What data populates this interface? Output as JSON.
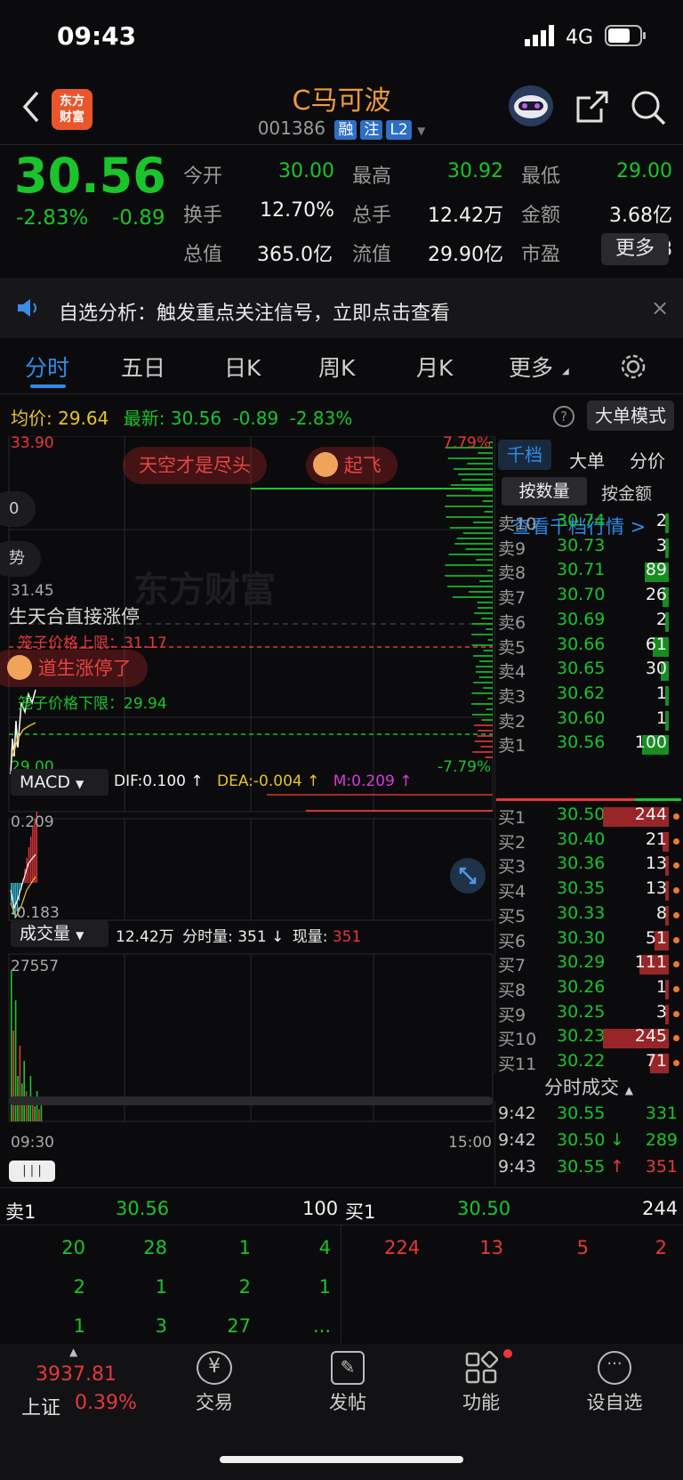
{
  "status": {
    "time": "09:43",
    "network": "4G"
  },
  "header": {
    "title": "C马可波",
    "code": "001386",
    "tags": [
      "融",
      "注",
      "L2"
    ],
    "logo_text": "东方\n财富"
  },
  "quote": {
    "price": "30.56",
    "change_pct": "-2.83%",
    "change": "-0.89",
    "cells": [
      {
        "label": "今开",
        "value": "30.00",
        "color": "green"
      },
      {
        "label": "最高",
        "value": "30.92",
        "color": "green"
      },
      {
        "label": "最低",
        "value": "29.00",
        "color": "green"
      },
      {
        "label": "换手",
        "value": "12.70%",
        "color": "white"
      },
      {
        "label": "总手",
        "value": "12.42万",
        "color": "white"
      },
      {
        "label": "金额",
        "value": "3.68亿",
        "color": "white"
      },
      {
        "label": "总值",
        "value": "365.0亿",
        "color": "white"
      },
      {
        "label": "流值",
        "value": "29.90亿",
        "color": "white"
      },
      {
        "label": "市盈",
        "value": "27.88",
        "color": "white"
      }
    ],
    "more_label": "更多"
  },
  "notice": {
    "text": "自选分析：触发重点关注信号，立即点击查看"
  },
  "tabs": [
    "分时",
    "五日",
    "日K",
    "周K",
    "月K",
    "更多"
  ],
  "avg_row": {
    "avg_label": "均价:",
    "avg_value": "29.64",
    "latest_label": "最新:",
    "latest_value": "30.56",
    "change": "-0.89",
    "change_pct": "-2.83%"
  },
  "big_order_label": "大单模式",
  "intraday": {
    "price_high": "33.90",
    "price_low": "29.00",
    "pct_high": "7.79%",
    "pct_low": "-7.79%",
    "mid_price": "31.45",
    "limit_upper": "笼子价格上限：31.17",
    "limit_lower": "笼子价格下限：29.94",
    "bubbles": [
      "天空才是尽头",
      "起飞",
      "生天合直接涨停",
      "道生涨停了"
    ],
    "side_chips": [
      "0",
      "势"
    ],
    "watermark": "东方财富"
  },
  "macd": {
    "label": "MACD",
    "dif": "DIF:0.100 ↑",
    "dea": "DEA:-0.004 ↑",
    "m": "M:0.209 ↑",
    "top": "0.209",
    "bottom": "-0.183"
  },
  "volume": {
    "label": "成交量",
    "total": "12.42万",
    "tick_label": "分时量: 351 ↓",
    "now_label": "现量:",
    "now_value": "351",
    "max": "27557",
    "time_start": "09:30",
    "time_end": "15:00"
  },
  "right_panel": {
    "tabs": [
      "千档",
      "大单",
      "分价"
    ],
    "sub_tabs": [
      "按数量",
      "按金额"
    ],
    "view_link": "查看千档行情 >",
    "asks": [
      {
        "label": "卖10",
        "price": "30.74",
        "vol": "2",
        "bar": 0.02
      },
      {
        "label": "卖9",
        "price": "30.73",
        "vol": "3",
        "bar": 0.03
      },
      {
        "label": "卖8",
        "price": "30.71",
        "vol": "89",
        "bar": 0.36
      },
      {
        "label": "卖7",
        "price": "30.70",
        "vol": "26",
        "bar": 0.1
      },
      {
        "label": "卖6",
        "price": "30.69",
        "vol": "2",
        "bar": 0.02
      },
      {
        "label": "卖5",
        "price": "30.66",
        "vol": "61",
        "bar": 0.25
      },
      {
        "label": "卖4",
        "price": "30.65",
        "vol": "30",
        "bar": 0.12
      },
      {
        "label": "卖3",
        "price": "30.62",
        "vol": "1",
        "bar": 0.01
      },
      {
        "label": "卖2",
        "price": "30.60",
        "vol": "1",
        "bar": 0.01
      },
      {
        "label": "卖1",
        "price": "30.56",
        "vol": "100",
        "bar": 0.4
      }
    ],
    "bids": [
      {
        "label": "买1",
        "price": "30.50",
        "vol": "244",
        "bar": 1.0,
        "dot": true
      },
      {
        "label": "买2",
        "price": "30.40",
        "vol": "21",
        "bar": 0.09,
        "dot": true
      },
      {
        "label": "买3",
        "price": "30.36",
        "vol": "13",
        "bar": 0.05,
        "dot": true
      },
      {
        "label": "买4",
        "price": "30.35",
        "vol": "13",
        "bar": 0.05,
        "dot": true
      },
      {
        "label": "买5",
        "price": "30.33",
        "vol": "8",
        "bar": 0.03,
        "dot": true
      },
      {
        "label": "买6",
        "price": "30.30",
        "vol": "51",
        "bar": 0.21,
        "dot": true
      },
      {
        "label": "买7",
        "price": "30.29",
        "vol": "111",
        "bar": 0.45,
        "dot": true
      },
      {
        "label": "买8",
        "price": "30.26",
        "vol": "1",
        "bar": 0.01,
        "dot": true
      },
      {
        "label": "买9",
        "price": "30.25",
        "vol": "3",
        "bar": 0.01,
        "dot": true
      },
      {
        "label": "买10",
        "price": "30.23",
        "vol": "245",
        "bar": 1.0,
        "dot": true
      },
      {
        "label": "买11",
        "price": "30.22",
        "vol": "71",
        "bar": 0.29,
        "dot": true
      }
    ],
    "trades_title": "分时成交",
    "trades": [
      {
        "time": "9:42",
        "price": "30.55",
        "vol": "331",
        "arrow": ""
      },
      {
        "time": "9:42",
        "price": "30.50",
        "vol": "289",
        "arrow": "↓"
      },
      {
        "time": "9:43",
        "price": "30.55",
        "vol": "351",
        "arrow": "↑"
      }
    ]
  },
  "level2": {
    "sell_label": "卖1",
    "sell_price": "30.56",
    "sell_vol": "100",
    "buy_label": "买1",
    "buy_price": "30.50",
    "buy_vol": "244",
    "sell_queue": [
      [
        "20",
        "28",
        "1",
        "4"
      ],
      [
        "2",
        "1",
        "2",
        "1"
      ],
      [
        "1",
        "3",
        "27",
        "..."
      ]
    ],
    "buy_queue": [
      [
        "224",
        "13",
        "5",
        "2"
      ]
    ]
  },
  "nav": {
    "index_value": "3937.81",
    "index_name": "上证",
    "index_pct": "0.39%",
    "items": [
      "交易",
      "发帖",
      "功能",
      "设自选"
    ]
  }
}
